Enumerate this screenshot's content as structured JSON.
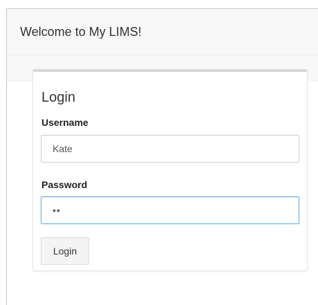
{
  "app": {
    "brand": "Welcome to My LIMS!"
  },
  "login": {
    "title": "Login",
    "username_label": "Username",
    "username_value": "Kate",
    "password_label": "Password",
    "password_value": "••",
    "submit_label": "Login"
  },
  "colors": {
    "focus_border": "#66afe9",
    "navbar_background": "#f8f8f8"
  }
}
